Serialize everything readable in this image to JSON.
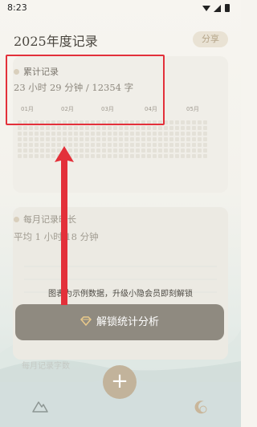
{
  "status_bar": {
    "time": "8:23"
  },
  "header": {
    "title": "2025年度记录",
    "share_label": "分享"
  },
  "cumulative": {
    "label": "累计记录",
    "summary": "23 小时 29 分钟 / 12354 字",
    "months": [
      "01月",
      "02月",
      "03月",
      "04月",
      "05月"
    ]
  },
  "monthly": {
    "label": "每月记录时长",
    "average": "平均 1 小时 18 分钟"
  },
  "paywall": {
    "note": "图表为示例数据，升级小隐会员即刻解锁",
    "unlock_label": "解锁统计分析"
  },
  "faint_section": {
    "label": "每月记录字数"
  },
  "nav": {
    "add_symbol": "+",
    "left_icon": "mountain-icon",
    "right_icon": "moon-clock-icon"
  },
  "colors": {
    "highlight": "#e3303a",
    "accent": "#c2b39b"
  }
}
